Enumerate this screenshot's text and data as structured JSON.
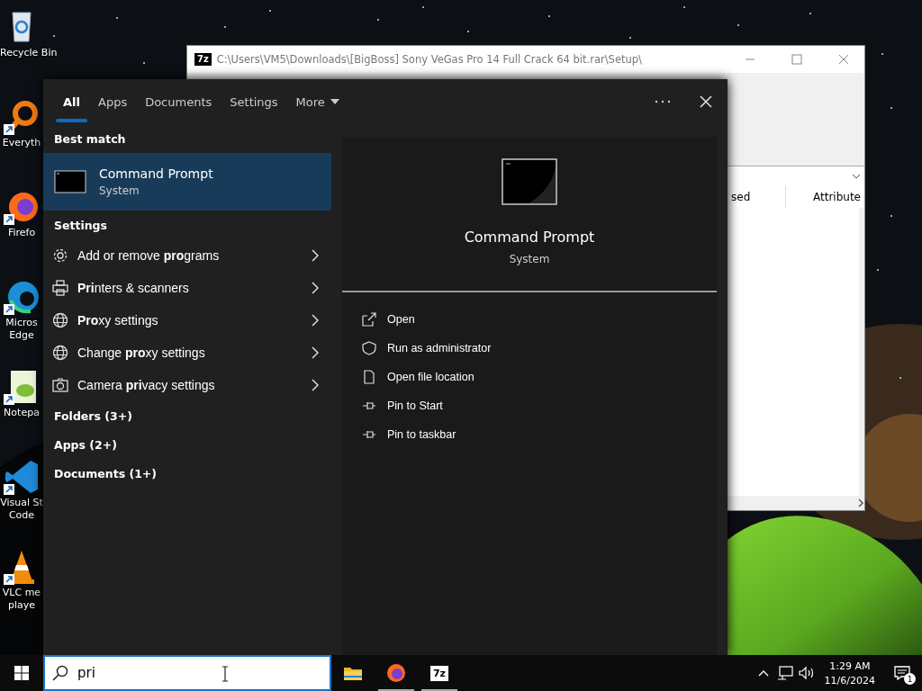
{
  "desktop_icons": [
    {
      "kind": "recycle-bin",
      "shortcut": false,
      "lines": [
        "Recycle Bin"
      ]
    },
    {
      "kind": "search-app",
      "shortcut": true,
      "lines": [
        "Everyth"
      ]
    },
    {
      "kind": "firefox",
      "shortcut": true,
      "lines": [
        "Firefo"
      ]
    },
    {
      "kind": "edge",
      "shortcut": true,
      "lines": [
        "Micros",
        "Edge"
      ]
    },
    {
      "kind": "notepad",
      "shortcut": true,
      "lines": [
        "Notepa"
      ]
    },
    {
      "kind": "vscode",
      "shortcut": true,
      "lines": [
        "Visual St",
        "Code"
      ]
    },
    {
      "kind": "vlc",
      "shortcut": true,
      "lines": [
        "VLC me",
        "playe"
      ]
    }
  ],
  "archive_window": {
    "app_badge": "7z",
    "title": "C:\\Users\\VM5\\Downloads\\[BigBoss] Sony VeGas Pro 14 Full Crack 64 bit.rar\\Setup\\",
    "column_headers": [
      "sed",
      "Attribute"
    ]
  },
  "search_panel": {
    "tabs": [
      {
        "label": "All",
        "selected": true,
        "has_menu": false
      },
      {
        "label": "Apps",
        "selected": false,
        "has_menu": false
      },
      {
        "label": "Documents",
        "selected": false,
        "has_menu": false
      },
      {
        "label": "Settings",
        "selected": false,
        "has_menu": false
      },
      {
        "label": "More",
        "selected": false,
        "has_menu": true
      }
    ],
    "best_match": {
      "heading": "Best match",
      "title": "Command Prompt",
      "subtitle": "System",
      "selected": true
    },
    "settings": {
      "heading": "Settings",
      "items": [
        {
          "kind": "gear",
          "label": "Add or remove **pro**grams"
        },
        {
          "kind": "printer",
          "label": "**Pri**nters & scanners"
        },
        {
          "kind": "globe",
          "label": "**Pro**xy settings"
        },
        {
          "kind": "globe",
          "label": "Change **pro**xy settings"
        },
        {
          "kind": "camera",
          "label": "Camera **pri**vacy settings"
        }
      ]
    },
    "categories": [
      "Folders (3+)",
      "Apps (2+)",
      "Documents (1+)"
    ],
    "preview": {
      "title": "Command Prompt",
      "subtitle": "System",
      "actions": [
        {
          "kind": "open",
          "label": "Open"
        },
        {
          "kind": "shield",
          "label": "Run as administrator"
        },
        {
          "kind": "file",
          "label": "Open file location"
        },
        {
          "kind": "pin",
          "label": "Pin to Start"
        },
        {
          "kind": "pin",
          "label": "Pin to taskbar"
        }
      ]
    }
  },
  "taskbar": {
    "search_field": {
      "value": "pri"
    },
    "apps": [
      {
        "kind": "file-explorer",
        "running": false
      },
      {
        "kind": "firefox",
        "running": true
      },
      {
        "kind": "archiver",
        "running": true,
        "badge": "7z"
      }
    ],
    "clock": {
      "time": "1:29 AM",
      "date": "11/6/2024"
    },
    "notifications": {
      "count": "1"
    }
  }
}
